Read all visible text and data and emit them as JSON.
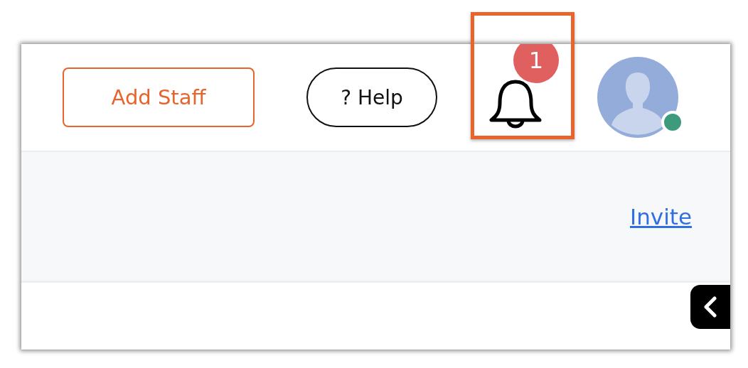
{
  "header": {
    "add_staff_button": "Add Staff",
    "help_button": "? Help",
    "notifications": {
      "badge": "1",
      "highlighted": true
    },
    "avatar": {
      "online": true
    }
  },
  "invite_link": "Invite",
  "collapse_tab": {
    "kind": "chevron-left"
  }
}
